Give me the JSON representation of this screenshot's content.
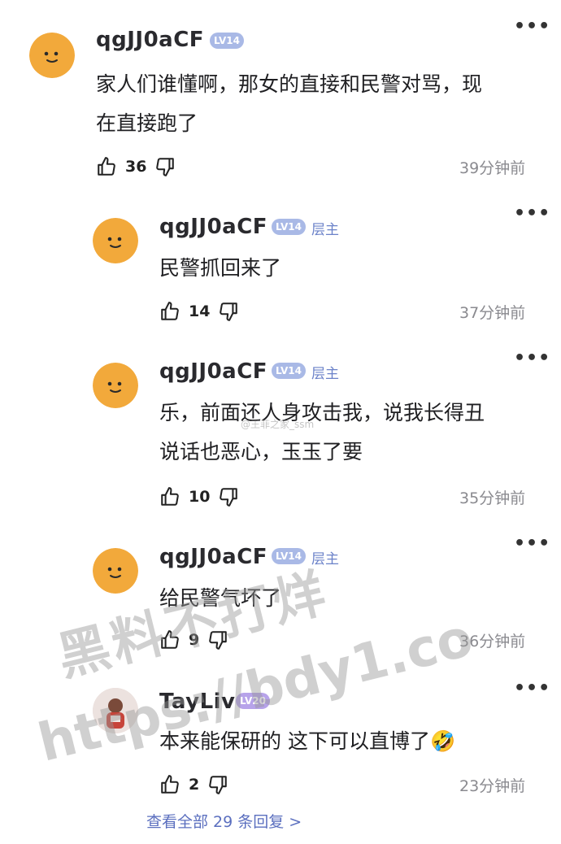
{
  "comments": [
    {
      "username": "qgJJ0aCF",
      "level": "LV14",
      "is_op": false,
      "text_lines": [
        "家人们谁懂啊，那女的直接和民警对骂，现",
        "在直接跑了"
      ],
      "likes": "36",
      "time": "39分钟前"
    },
    {
      "username": "qgJJ0aCF",
      "level": "LV14",
      "op_label": "层主",
      "text_lines": [
        "民警抓回来了"
      ],
      "likes": "14",
      "time": "37分钟前"
    },
    {
      "username": "qgJJ0aCF",
      "level": "LV14",
      "op_label": "层主",
      "text_lines": [
        "乐，前面还人身攻击我，说我长得丑",
        "说话也恶心，玉玉了要"
      ],
      "likes": "10",
      "time": "35分钟前"
    },
    {
      "username": "qgJJ0aCF",
      "level": "LV14",
      "op_label": "层主",
      "text_lines": [
        "给民警气坏了"
      ],
      "likes": "9",
      "time": "36分钟前"
    },
    {
      "username": "TayLiv",
      "level": "LV20",
      "text_lines": [
        "本来能保研的 这下可以直博了🤣"
      ],
      "likes": "2",
      "time": "23分钟前"
    }
  ],
  "view_all": "查看全部 29 条回复 >",
  "watermarks": {
    "line1": "黑料不打烊",
    "line2": "https://bdy1.co",
    "small": "@王菲之家_ssm"
  },
  "icons": [
    "more-icon",
    "thumbs-up-icon",
    "thumbs-down-icon",
    "avatar-smiley-icon"
  ],
  "colors": {
    "level_badge": "#a9b9e6",
    "op_label": "#6b82c9",
    "link": "#5b6fbf",
    "avatar": "#f2a93b"
  }
}
